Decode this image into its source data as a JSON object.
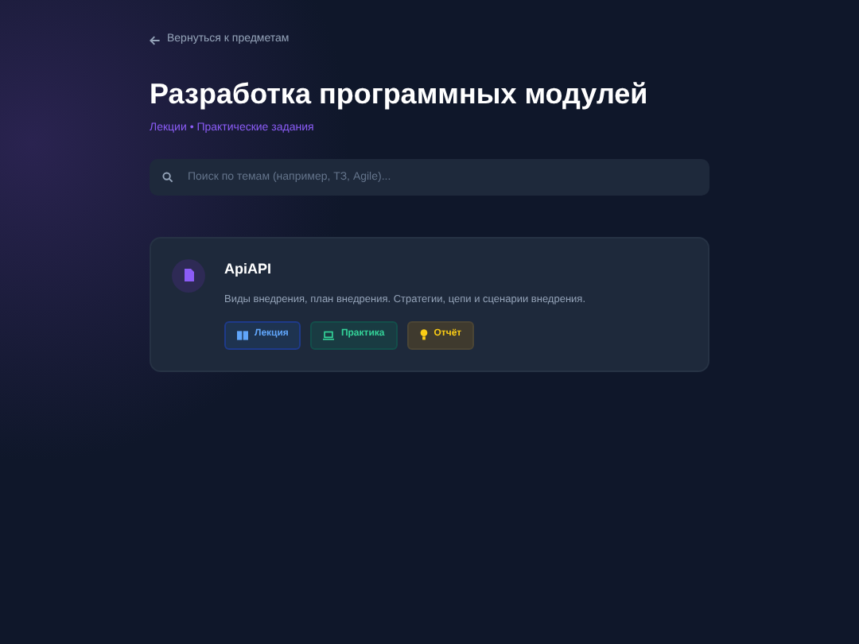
{
  "back_link": "Вернуться к предметам",
  "title": "Разработка программных модулей",
  "subtitle": "Лекции • Практические задания",
  "search": {
    "placeholder": "Поиск по темам (например, ТЗ, Agile)..."
  },
  "topics": [
    {
      "title": "ApiAPI",
      "description": "Виды внедрения, план внедрения. Стратегии, цепи и сценарии внедрения.",
      "buttons": [
        {
          "kind": "lecture",
          "label": "Лекция"
        },
        {
          "kind": "practice",
          "label": "Практика"
        },
        {
          "kind": "report",
          "label": "Отчёт"
        }
      ]
    }
  ]
}
